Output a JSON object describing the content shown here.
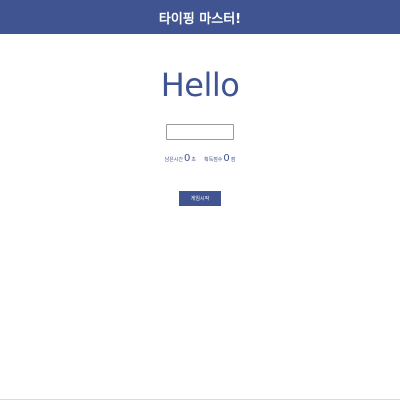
{
  "header": {
    "title": "타이핑 마스터!"
  },
  "game": {
    "word": "Hello",
    "input_value": "",
    "stats": {
      "time_label": "남은시간",
      "time_value": "0",
      "time_unit": "초",
      "score_label": "획득점수",
      "score_value": "0",
      "score_unit": "점"
    },
    "start_button_label": "게임시작"
  },
  "colors": {
    "primary": "#3f5490",
    "background": "#ffffff"
  }
}
